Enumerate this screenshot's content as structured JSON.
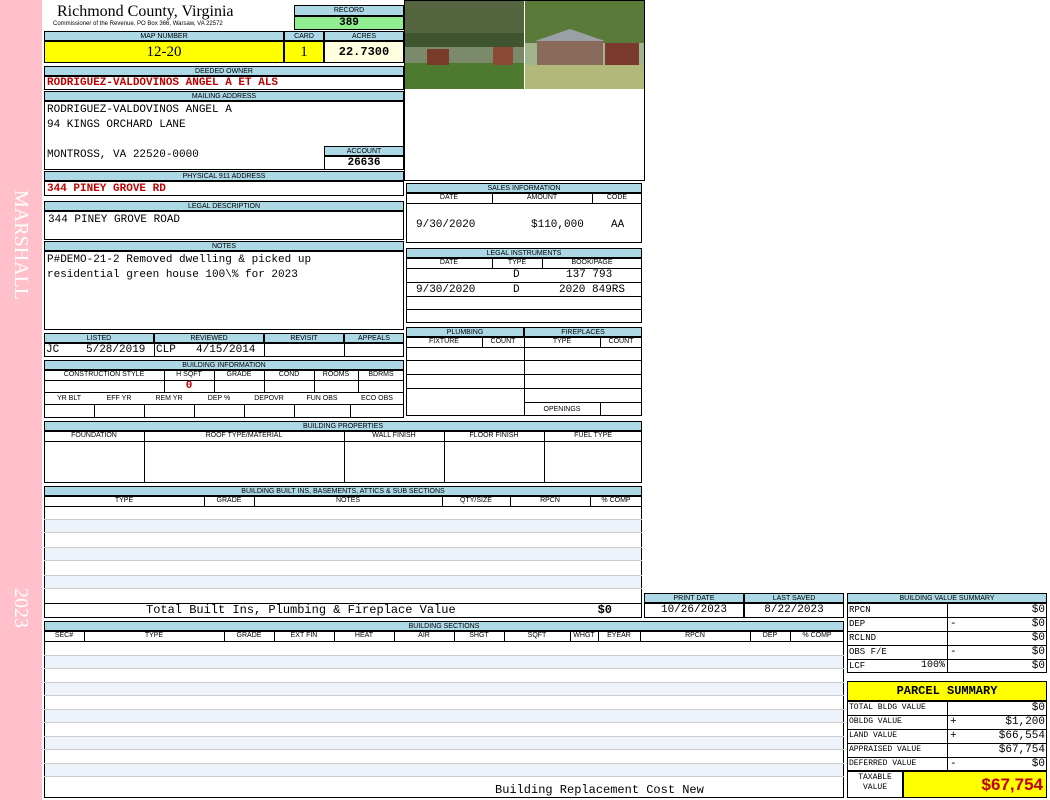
{
  "sidebar": {
    "district": "MARSHALL",
    "year": "2023"
  },
  "header": {
    "county": "Richmond County, Virginia",
    "commissioner": "Commissioner of the Revenue, PO Box 366, Warsaw, VA 22572"
  },
  "record": {
    "label": "RECORD",
    "value": "389"
  },
  "map": {
    "label": "MAP NUMBER",
    "value": "12-20"
  },
  "card": {
    "label": "CARD",
    "value": "1"
  },
  "acres": {
    "label": "ACRES",
    "value": "22.7300"
  },
  "owner": {
    "label": "DEEDED OWNER",
    "value": "RODRIGUEZ-VALDOVINOS ANGEL A ET ALS"
  },
  "mailing": {
    "label": "MAILING ADDRESS",
    "line1": "RODRIGUEZ-VALDOVINOS ANGEL A",
    "line2": "94 KINGS ORCHARD LANE",
    "line3": "MONTROSS, VA 22520-0000"
  },
  "account": {
    "label": "ACCOUNT",
    "value": "26636"
  },
  "physical": {
    "label": "PHYSICAL 911 ADDRESS",
    "value": "344 PINEY GROVE RD"
  },
  "legal": {
    "label": "LEGAL DESCRIPTION",
    "value": "344 PINEY GROVE ROAD"
  },
  "notes": {
    "label": "NOTES",
    "line1": "P#DEMO-21-2 Removed dwelling & picked up",
    "line2": "residential green house 100\\% for 2023"
  },
  "listed": {
    "label": "LISTED",
    "by": "JC",
    "date": "5/28/2019"
  },
  "reviewed": {
    "label": "REVIEWED",
    "by": "CLP",
    "date": "4/15/2014"
  },
  "revisit": {
    "label": "REVISIT"
  },
  "appeals": {
    "label": "APPEALS"
  },
  "building_info": {
    "label": "BUILDING INFORMATION",
    "cols1": [
      "CONSTRUCTION STYLE",
      "H SQFT",
      "GRADE",
      "COND",
      "ROOMS",
      "BDRMS"
    ],
    "hsqft": "0",
    "cols2": [
      "YR BLT",
      "EFF YR",
      "REM YR",
      "DEP %",
      "DEPOVR",
      "FUN OBS",
      "ECO OBS"
    ]
  },
  "sales": {
    "label": "SALES INFORMATION",
    "cols": [
      "DATE",
      "AMOUNT",
      "CODE"
    ],
    "date": "9/30/2020",
    "amount": "$110,000",
    "code": "AA"
  },
  "instruments": {
    "label": "LEGAL INSTRUMENTS",
    "cols": [
      "DATE",
      "TYPE",
      "BOOK/PAGE"
    ],
    "rows": [
      {
        "date": "",
        "type": "D",
        "book": "137 793"
      },
      {
        "date": "9/30/2020",
        "type": "D",
        "book": "2020 849RS"
      }
    ]
  },
  "plumbing": {
    "label": "PLUMBING",
    "cols": [
      "FIXTURE",
      "COUNT"
    ]
  },
  "fireplaces": {
    "label": "FIREPLACES",
    "cols": [
      "TYPE",
      "COUNT"
    ],
    "openings": "OPENINGS"
  },
  "properties": {
    "label": "BUILDING PROPERTIES",
    "cols": [
      "FOUNDATION",
      "ROOF TYPE/MATERIAL",
      "WALL FINISH",
      "FLOOR FINISH",
      "FUEL TYPE"
    ]
  },
  "builtins": {
    "label": "BUILDING BUILT INS, BASEMENTS, ATTICS & SUB SECTIONS",
    "cols": [
      "TYPE",
      "GRADE",
      "NOTES",
      "QTY/SIZE",
      "RPCN",
      "% COMP"
    ],
    "total_label": "Total Built Ins, Plumbing & Fireplace Value",
    "total_value": "$0"
  },
  "print": {
    "label": "PRINT DATE",
    "value": "10/26/2023"
  },
  "saved": {
    "label": "LAST SAVED",
    "value": "8/22/2023"
  },
  "sections": {
    "label": "BUILDING SECTIONS",
    "cols": [
      "SEC#",
      "TYPE",
      "GRADE",
      "EXT FIN",
      "HEAT",
      "AIR",
      "SHGT",
      "SQFT",
      "WHGT",
      "EYEAR",
      "RPCN",
      "DEP",
      "% COMP"
    ],
    "footer": "Building Replacement Cost New"
  },
  "value_summary": {
    "label": "BUILDING VALUE SUMMARY",
    "rows": [
      {
        "label": "RPCN",
        "sign": "",
        "value": "$0"
      },
      {
        "label": "DEP",
        "sign": "-",
        "value": "$0"
      },
      {
        "label": "RCLND",
        "sign": "",
        "value": "$0"
      },
      {
        "label": "OBS F/E",
        "sign": "-",
        "value": "$0"
      },
      {
        "label": "LCF",
        "pct": "100%",
        "sign": "",
        "value": "$0"
      }
    ]
  },
  "parcel": {
    "title": "PARCEL SUMMARY",
    "rows": [
      {
        "label": "TOTAL BLDG VALUE",
        "sign": "",
        "value": "$0"
      },
      {
        "label": "OBLDG VALUE",
        "sign": "+",
        "value": "$1,200"
      },
      {
        "label": "LAND VALUE",
        "sign": "+",
        "value": "$66,554"
      },
      {
        "label": "APPRAISED VALUE",
        "sign": "",
        "value": "$67,754"
      },
      {
        "label": "DEFERRED VALUE",
        "sign": "-",
        "value": "$0"
      }
    ],
    "taxable_line1": "TAXABLE",
    "taxable_line2": "VALUE",
    "taxable_value": "$67,754"
  },
  "colors": {
    "sidebar": "#ffc0cb",
    "header": "#add8e6",
    "yellow": "#ffff00",
    "record": "#90ee90",
    "red": "#c00000"
  }
}
